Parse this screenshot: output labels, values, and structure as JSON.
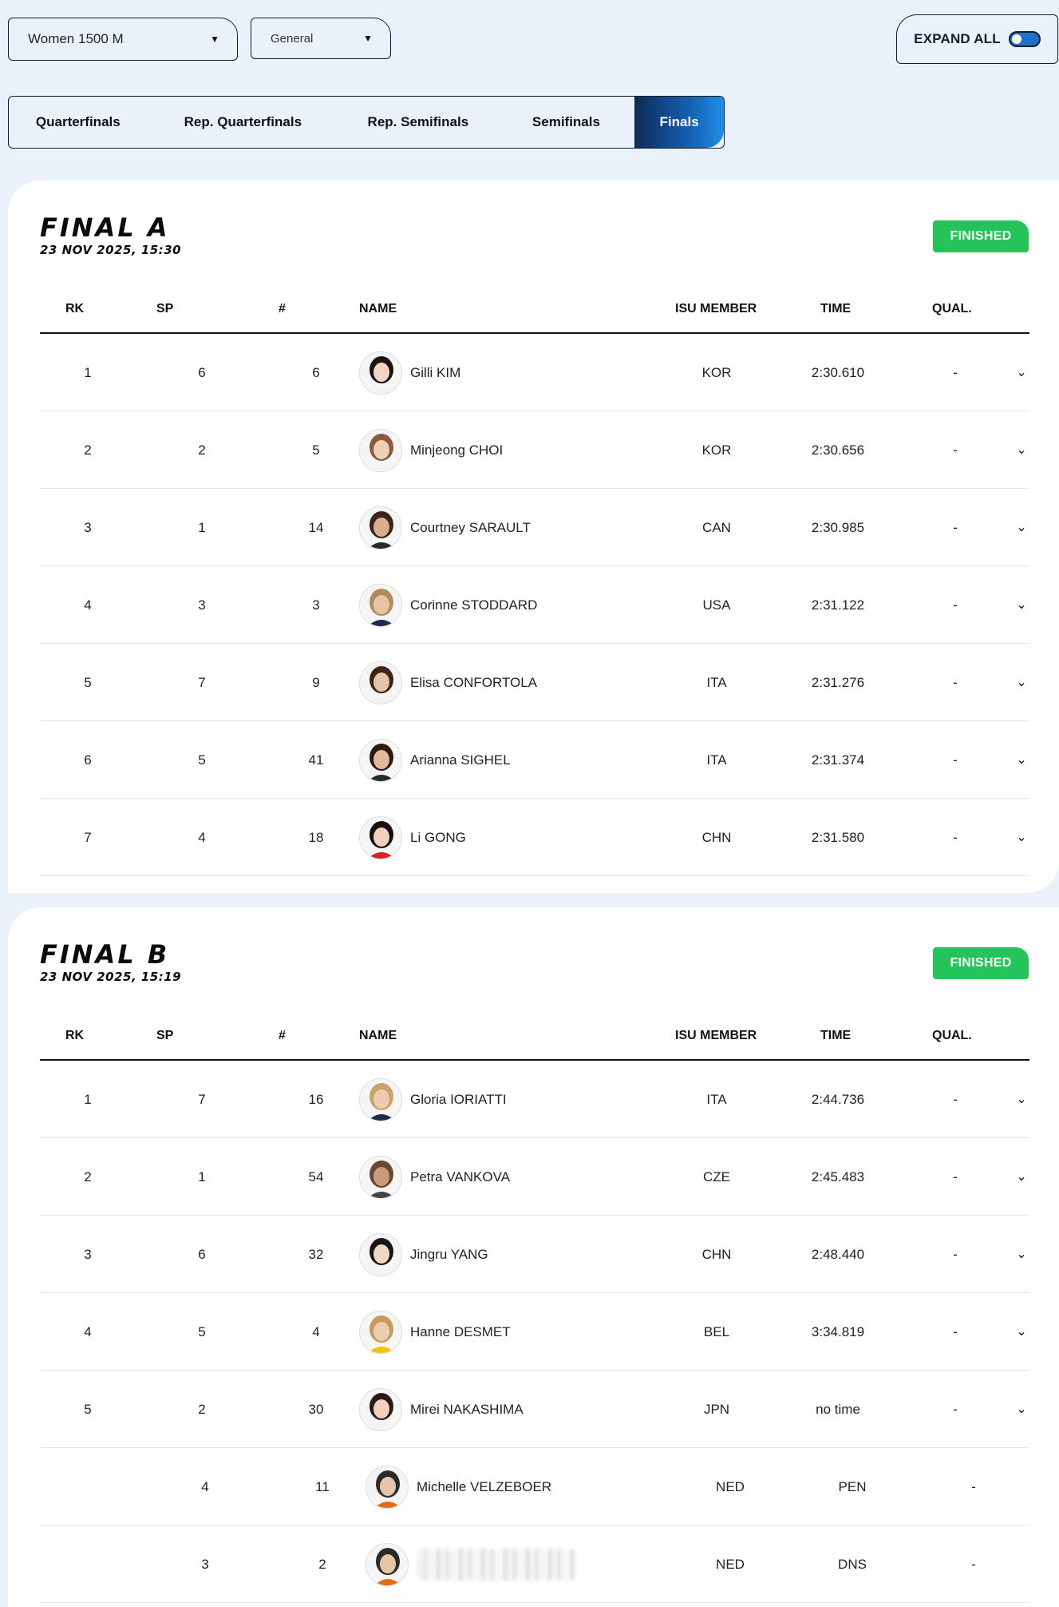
{
  "filters": {
    "event": "Women 1500 M",
    "category": "General",
    "expand_all_label": "EXPAND ALL"
  },
  "tabs": [
    {
      "label": "Quarterfinals",
      "active": false
    },
    {
      "label": "Rep. Quarterfinals",
      "active": false
    },
    {
      "label": "Rep. Semifinals",
      "active": false
    },
    {
      "label": "Semifinals",
      "active": false
    },
    {
      "label": "Finals",
      "active": true
    }
  ],
  "columns": {
    "rk": "RK",
    "sp": "SP",
    "num": "#",
    "name": "NAME",
    "nat": "ISU MEMBER",
    "time": "TIME",
    "qual": "QUAL."
  },
  "finals": [
    {
      "title": "FINAL A",
      "date": "23 NOV 2025, 15:30",
      "status": "FINISHED",
      "rows": [
        {
          "rk": "1",
          "sp": "6",
          "num": "6",
          "name": "Gilli KIM",
          "nat": "KOR",
          "time": "2:30.610",
          "qual": "-",
          "hair": "#1a1414",
          "skin": "#f2d6c4",
          "suit": "#f3f3f3"
        },
        {
          "rk": "2",
          "sp": "2",
          "num": "5",
          "name": "Minjeong CHOI",
          "nat": "KOR",
          "time": "2:30.656",
          "qual": "-",
          "hair": "#8a5a3c",
          "skin": "#f0cfb7",
          "suit": "#f3f3f3"
        },
        {
          "rk": "3",
          "sp": "1",
          "num": "14",
          "name": "Courtney SARAULT",
          "nat": "CAN",
          "time": "2:30.985",
          "qual": "-",
          "hair": "#3b2418",
          "skin": "#d9ae8d",
          "suit": "#2a2a2a"
        },
        {
          "rk": "4",
          "sp": "3",
          "num": "3",
          "name": "Corinne STODDARD",
          "nat": "USA",
          "time": "2:31.122",
          "qual": "-",
          "hair": "#b08b5e",
          "skin": "#e8c4a6",
          "suit": "#1b2d52"
        },
        {
          "rk": "5",
          "sp": "7",
          "num": "9",
          "name": "Elisa CONFORTOLA",
          "nat": "ITA",
          "time": "2:31.276",
          "qual": "-",
          "hair": "#3a2518",
          "skin": "#e6c2a6",
          "suit": "#f3f3f3"
        },
        {
          "rk": "6",
          "sp": "5",
          "num": "41",
          "name": "Arianna SIGHEL",
          "nat": "ITA",
          "time": "2:31.374",
          "qual": "-",
          "hair": "#2b1a12",
          "skin": "#e3bb9c",
          "suit": "#2a2a2a"
        },
        {
          "rk": "7",
          "sp": "4",
          "num": "18",
          "name": "Li GONG",
          "nat": "CHN",
          "time": "2:31.580",
          "qual": "-",
          "hair": "#141010",
          "skin": "#f0d0b8",
          "suit": "#d32323"
        }
      ]
    },
    {
      "title": "FINAL B",
      "date": "23 NOV 2025, 15:19",
      "status": "FINISHED",
      "rows": [
        {
          "rk": "1",
          "sp": "7",
          "num": "16",
          "name": "Gloria IORIATTI",
          "nat": "ITA",
          "time": "2:44.736",
          "qual": "-",
          "hair": "#c8a36a",
          "skin": "#eccbb0",
          "suit": "#1f2d4d"
        },
        {
          "rk": "2",
          "sp": "1",
          "num": "54",
          "name": "Petra VANKOVA",
          "nat": "CZE",
          "time": "2:45.483",
          "qual": "-",
          "hair": "#6b4630",
          "skin": "#c99b7a",
          "suit": "#444"
        },
        {
          "rk": "3",
          "sp": "6",
          "num": "32",
          "name": "Jingru YANG",
          "nat": "CHN",
          "time": "2:48.440",
          "qual": "-",
          "hair": "#1a1414",
          "skin": "#f2d6c4",
          "suit": "#f3f3f3"
        },
        {
          "rk": "4",
          "sp": "5",
          "num": "4",
          "name": "Hanne DESMET",
          "nat": "BEL",
          "time": "3:34.819",
          "qual": "-",
          "hair": "#c59a5a",
          "skin": "#edcdb2",
          "suit": "#f2c200"
        },
        {
          "rk": "5",
          "sp": "2",
          "num": "30",
          "name": "Mirei NAKASHIMA",
          "nat": "JPN",
          "time": "no time",
          "qual": "-",
          "hair": "#2a1a14",
          "skin": "#f0d2bc",
          "suit": "#f3f3f3"
        },
        {
          "rk": "",
          "sp": "4",
          "num": "11",
          "name": "Michelle VELZEBOER",
          "nat": "NED",
          "time": "PEN",
          "qual": "-",
          "hair": "#2a2a2a",
          "skin": "#e8c4a6",
          "suit": "#e86a10",
          "dq": true
        },
        {
          "rk": "",
          "sp": "3",
          "num": "2",
          "name": "",
          "nat": "NED",
          "time": "DNS",
          "qual": "-",
          "hair": "#2a2a2a",
          "skin": "#e8c4a6",
          "suit": "#e86a10",
          "dq": true,
          "blurred": true
        }
      ]
    }
  ]
}
